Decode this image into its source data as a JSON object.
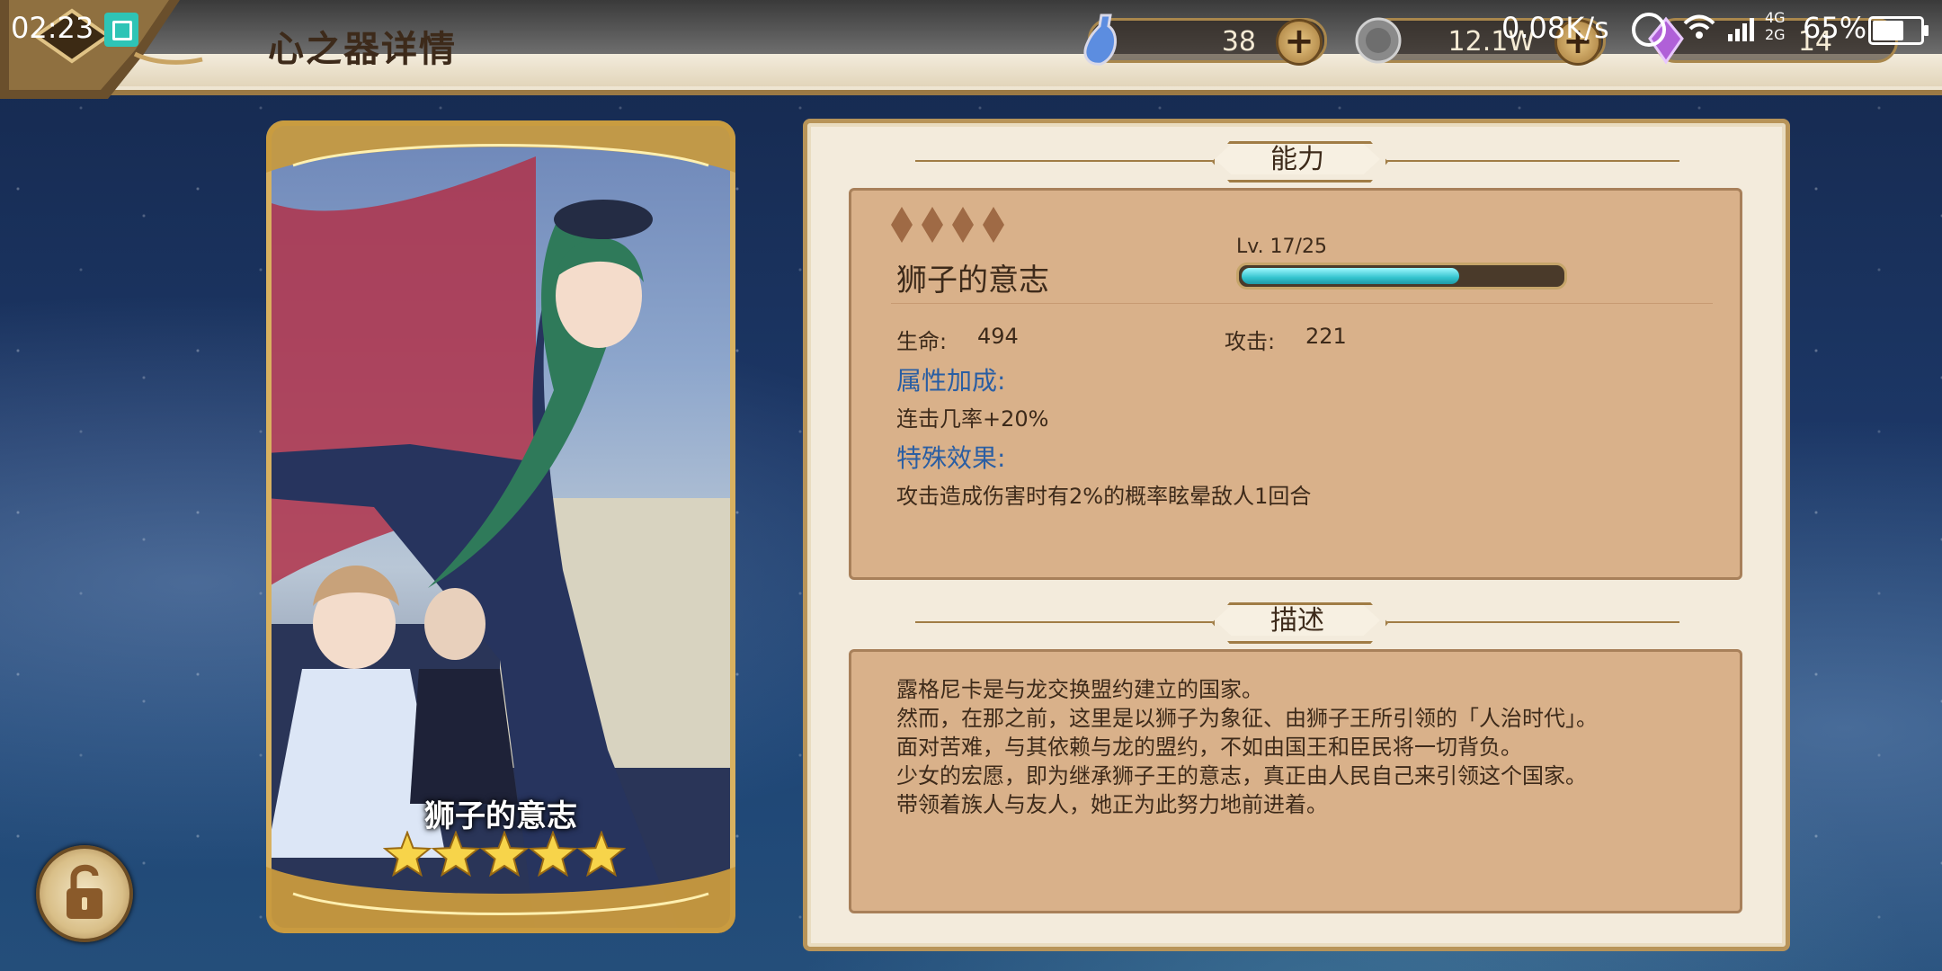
{
  "status_bar": {
    "time": "02:23",
    "net_speed": "0.08K/s",
    "network_labels": [
      "4G",
      "2G"
    ],
    "battery_pct": "65%",
    "battery_level": 0.65
  },
  "header": {
    "title": "心之器详情"
  },
  "resources": [
    {
      "name": "crystal",
      "value": "38"
    },
    {
      "name": "coin",
      "value": "12.1W"
    },
    {
      "name": "gem",
      "value": "14"
    }
  ],
  "card": {
    "name": "狮子的意志",
    "stars": 5
  },
  "ability": {
    "section_title": "能力",
    "rarity_diamonds": 4,
    "item_name": "狮子的意志",
    "level_text": "Lv.  17/25",
    "level_progress": 0.68,
    "hp_label": "生命:",
    "hp_value": "494",
    "atk_label": "攻击:",
    "atk_value": "221",
    "attr_bonus_label": "属性加成:",
    "attr_bonus_text": "连击几率+20%",
    "special_label": "特殊效果:",
    "special_text": "攻击造成伤害时有2%的概率眩晕敌人1回合"
  },
  "description": {
    "section_title": "描述",
    "lines": [
      "露格尼卡是与龙交换盟约建立的国家。",
      "然而，在那之前，这里是以狮子为象征、由狮子王所引领的「人治时代」。",
      "面对苦难，与其依赖与龙的盟约，不如由国王和臣民将一切背负。",
      "少女的宏愿，即为继承狮子王的意志，真正由人民自己来引领这个国家。",
      "带领着族人与友人，她正为此努力地前进着。"
    ]
  },
  "colors": {
    "panel_bg": "#f3ebdc",
    "box_bg": "#d9b18a",
    "accent_gold": "#b89459",
    "text_dark": "#3d2a1a",
    "label_blue": "#2a5ea3",
    "bar_fill": "#33c4cf"
  },
  "icons": {
    "lock": "lock-open-icon",
    "crystal": "potion-icon",
    "coin": "coin-icon",
    "plus": "plus-icon"
  }
}
